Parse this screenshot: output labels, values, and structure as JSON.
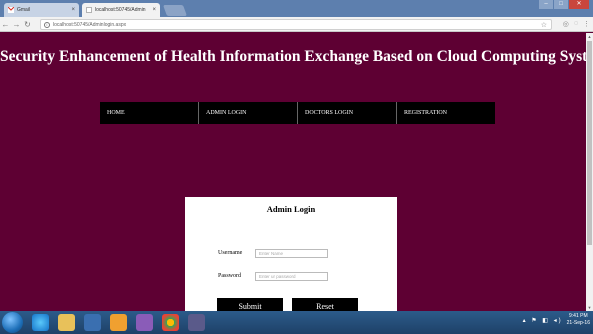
{
  "browser": {
    "tabs": [
      {
        "title": "Gmail",
        "active": false
      },
      {
        "title": "localhost:50745/Admin",
        "active": true
      }
    ],
    "url": "localhost:50745/Adminlogin.aspx"
  },
  "site": {
    "title": "Security Enhancement of Health Information Exchange Based on Cloud Computing System",
    "nav": [
      "HOME",
      "ADMIN LOGIN",
      "DOCTORS LOGIN",
      "REGISTRATION"
    ]
  },
  "login": {
    "title": "Admin Login",
    "username_label": "Username",
    "username_placeholder": "Enter Name",
    "password_label": "Password",
    "password_placeholder": "Enter ur password",
    "submit_label": "Submit",
    "reset_label": "Reset"
  },
  "taskbar": {
    "time": "9:41 PM",
    "date": "21-Sep-16"
  },
  "colors": {
    "page_background": "#5e0033",
    "nav_background": "#000000",
    "login_box": "#ffffff"
  }
}
